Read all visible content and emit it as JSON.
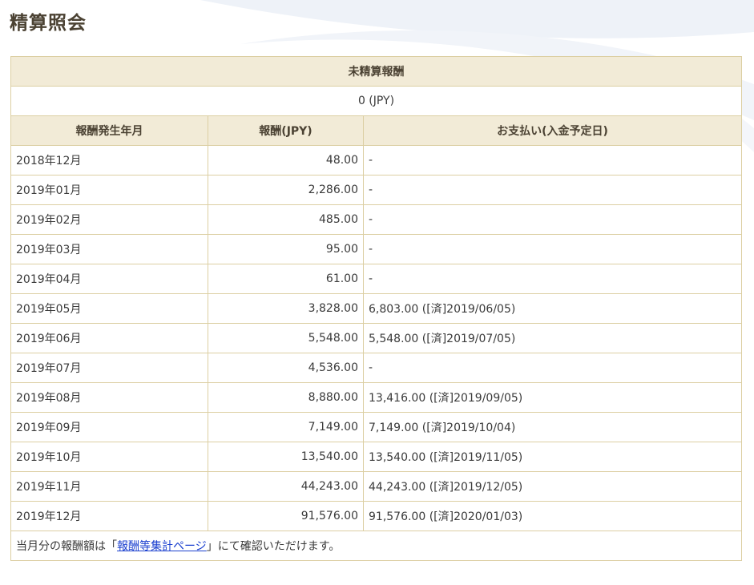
{
  "page": {
    "title": "精算照会"
  },
  "summary": {
    "header": "未精算報酬",
    "value": "0 (JPY)"
  },
  "table": {
    "columns": [
      "報酬発生年月",
      "報酬(JPY)",
      "お支払い(入金予定日)"
    ],
    "rows": [
      [
        "2018年12月",
        "48.00",
        "-"
      ],
      [
        "2019年01月",
        "2,286.00",
        "-"
      ],
      [
        "2019年02月",
        "485.00",
        "-"
      ],
      [
        "2019年03月",
        "95.00",
        "-"
      ],
      [
        "2019年04月",
        "61.00",
        "-"
      ],
      [
        "2019年05月",
        "3,828.00",
        "6,803.00 ([済]2019/06/05)"
      ],
      [
        "2019年06月",
        "5,548.00",
        "5,548.00 ([済]2019/07/05)"
      ],
      [
        "2019年07月",
        "4,536.00",
        "-"
      ],
      [
        "2019年08月",
        "8,880.00",
        "13,416.00 ([済]2019/09/05)"
      ],
      [
        "2019年09月",
        "7,149.00",
        "7,149.00 ([済]2019/10/04)"
      ],
      [
        "2019年10月",
        "13,540.00",
        "13,540.00 ([済]2019/11/05)"
      ],
      [
        "2019年11月",
        "44,243.00",
        "44,243.00 ([済]2019/12/05)"
      ],
      [
        "2019年12月",
        "91,576.00",
        "91,576.00 ([済]2020/01/03)"
      ]
    ]
  },
  "footer": {
    "text_before": "当月分の報酬額は「",
    "link_label": "報酬等集計ページ",
    "text_after": "」にて確認いただけます。"
  }
}
